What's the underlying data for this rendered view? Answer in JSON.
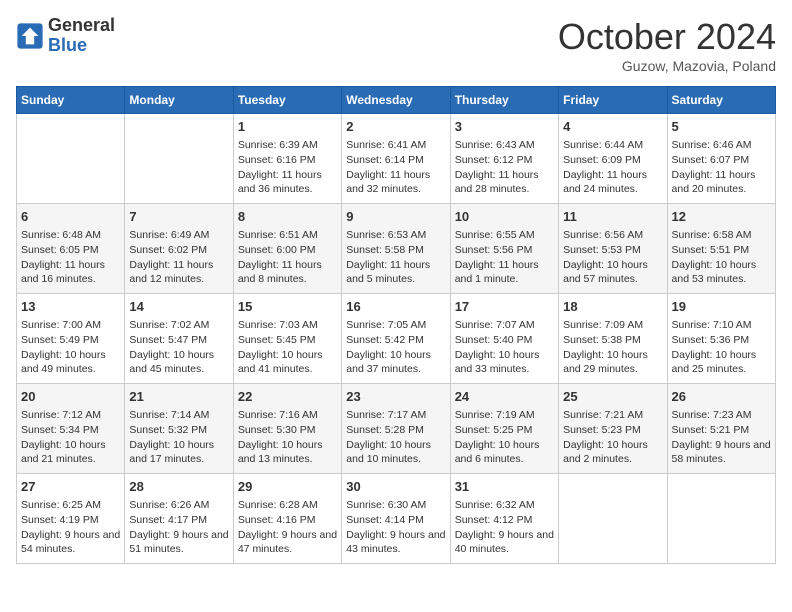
{
  "header": {
    "logo_general": "General",
    "logo_blue": "Blue",
    "month_title": "October 2024",
    "location": "Guzow, Mazovia, Poland"
  },
  "days_of_week": [
    "Sunday",
    "Monday",
    "Tuesday",
    "Wednesday",
    "Thursday",
    "Friday",
    "Saturday"
  ],
  "weeks": [
    [
      {
        "day": "",
        "info": ""
      },
      {
        "day": "",
        "info": ""
      },
      {
        "day": "1",
        "info": "Sunrise: 6:39 AM\nSunset: 6:16 PM\nDaylight: 11 hours and 36 minutes."
      },
      {
        "day": "2",
        "info": "Sunrise: 6:41 AM\nSunset: 6:14 PM\nDaylight: 11 hours and 32 minutes."
      },
      {
        "day": "3",
        "info": "Sunrise: 6:43 AM\nSunset: 6:12 PM\nDaylight: 11 hours and 28 minutes."
      },
      {
        "day": "4",
        "info": "Sunrise: 6:44 AM\nSunset: 6:09 PM\nDaylight: 11 hours and 24 minutes."
      },
      {
        "day": "5",
        "info": "Sunrise: 6:46 AM\nSunset: 6:07 PM\nDaylight: 11 hours and 20 minutes."
      }
    ],
    [
      {
        "day": "6",
        "info": "Sunrise: 6:48 AM\nSunset: 6:05 PM\nDaylight: 11 hours and 16 minutes."
      },
      {
        "day": "7",
        "info": "Sunrise: 6:49 AM\nSunset: 6:02 PM\nDaylight: 11 hours and 12 minutes."
      },
      {
        "day": "8",
        "info": "Sunrise: 6:51 AM\nSunset: 6:00 PM\nDaylight: 11 hours and 8 minutes."
      },
      {
        "day": "9",
        "info": "Sunrise: 6:53 AM\nSunset: 5:58 PM\nDaylight: 11 hours and 5 minutes."
      },
      {
        "day": "10",
        "info": "Sunrise: 6:55 AM\nSunset: 5:56 PM\nDaylight: 11 hours and 1 minute."
      },
      {
        "day": "11",
        "info": "Sunrise: 6:56 AM\nSunset: 5:53 PM\nDaylight: 10 hours and 57 minutes."
      },
      {
        "day": "12",
        "info": "Sunrise: 6:58 AM\nSunset: 5:51 PM\nDaylight: 10 hours and 53 minutes."
      }
    ],
    [
      {
        "day": "13",
        "info": "Sunrise: 7:00 AM\nSunset: 5:49 PM\nDaylight: 10 hours and 49 minutes."
      },
      {
        "day": "14",
        "info": "Sunrise: 7:02 AM\nSunset: 5:47 PM\nDaylight: 10 hours and 45 minutes."
      },
      {
        "day": "15",
        "info": "Sunrise: 7:03 AM\nSunset: 5:45 PM\nDaylight: 10 hours and 41 minutes."
      },
      {
        "day": "16",
        "info": "Sunrise: 7:05 AM\nSunset: 5:42 PM\nDaylight: 10 hours and 37 minutes."
      },
      {
        "day": "17",
        "info": "Sunrise: 7:07 AM\nSunset: 5:40 PM\nDaylight: 10 hours and 33 minutes."
      },
      {
        "day": "18",
        "info": "Sunrise: 7:09 AM\nSunset: 5:38 PM\nDaylight: 10 hours and 29 minutes."
      },
      {
        "day": "19",
        "info": "Sunrise: 7:10 AM\nSunset: 5:36 PM\nDaylight: 10 hours and 25 minutes."
      }
    ],
    [
      {
        "day": "20",
        "info": "Sunrise: 7:12 AM\nSunset: 5:34 PM\nDaylight: 10 hours and 21 minutes."
      },
      {
        "day": "21",
        "info": "Sunrise: 7:14 AM\nSunset: 5:32 PM\nDaylight: 10 hours and 17 minutes."
      },
      {
        "day": "22",
        "info": "Sunrise: 7:16 AM\nSunset: 5:30 PM\nDaylight: 10 hours and 13 minutes."
      },
      {
        "day": "23",
        "info": "Sunrise: 7:17 AM\nSunset: 5:28 PM\nDaylight: 10 hours and 10 minutes."
      },
      {
        "day": "24",
        "info": "Sunrise: 7:19 AM\nSunset: 5:25 PM\nDaylight: 10 hours and 6 minutes."
      },
      {
        "day": "25",
        "info": "Sunrise: 7:21 AM\nSunset: 5:23 PM\nDaylight: 10 hours and 2 minutes."
      },
      {
        "day": "26",
        "info": "Sunrise: 7:23 AM\nSunset: 5:21 PM\nDaylight: 9 hours and 58 minutes."
      }
    ],
    [
      {
        "day": "27",
        "info": "Sunrise: 6:25 AM\nSunset: 4:19 PM\nDaylight: 9 hours and 54 minutes."
      },
      {
        "day": "28",
        "info": "Sunrise: 6:26 AM\nSunset: 4:17 PM\nDaylight: 9 hours and 51 minutes."
      },
      {
        "day": "29",
        "info": "Sunrise: 6:28 AM\nSunset: 4:16 PM\nDaylight: 9 hours and 47 minutes."
      },
      {
        "day": "30",
        "info": "Sunrise: 6:30 AM\nSunset: 4:14 PM\nDaylight: 9 hours and 43 minutes."
      },
      {
        "day": "31",
        "info": "Sunrise: 6:32 AM\nSunset: 4:12 PM\nDaylight: 9 hours and 40 minutes."
      },
      {
        "day": "",
        "info": ""
      },
      {
        "day": "",
        "info": ""
      }
    ]
  ]
}
